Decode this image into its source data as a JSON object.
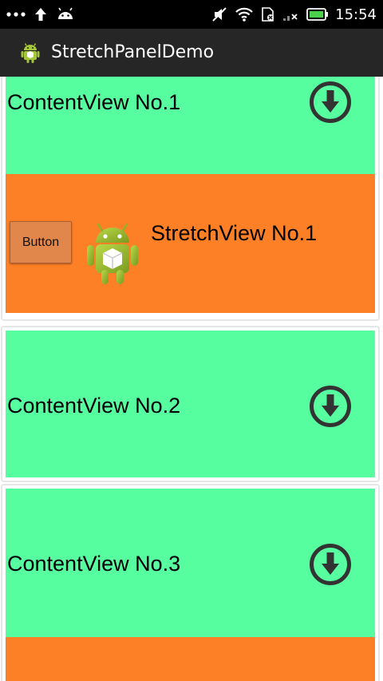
{
  "status_bar": {
    "time": "15:54",
    "icons": [
      "more-icon",
      "upload-icon",
      "android-notification-icon",
      "mute-icon",
      "wifi-icon",
      "sim-icon",
      "signal-icon",
      "battery-icon"
    ],
    "battery_color": "#4cd14c"
  },
  "action_bar": {
    "title": "StretchPanelDemo",
    "app_icon": "android-icon"
  },
  "panels": [
    {
      "content_label": "ContentView No.1",
      "arrow_icon": "arrow-down-circle-icon",
      "expanded": true,
      "stretch": {
        "button_label": "Button",
        "robot_icon": "android-robot-icon",
        "label": "StretchView No.1"
      }
    },
    {
      "content_label": "ContentView No.2",
      "arrow_icon": "arrow-down-circle-icon",
      "expanded": false
    },
    {
      "content_label": "ContentView No.3",
      "arrow_icon": "arrow-down-circle-icon",
      "expanded": true
    }
  ],
  "colors": {
    "content_bg": "#56fea0",
    "stretch_bg": "#fe8026",
    "action_bar_bg": "#262626",
    "status_bar_bg": "#000000"
  }
}
